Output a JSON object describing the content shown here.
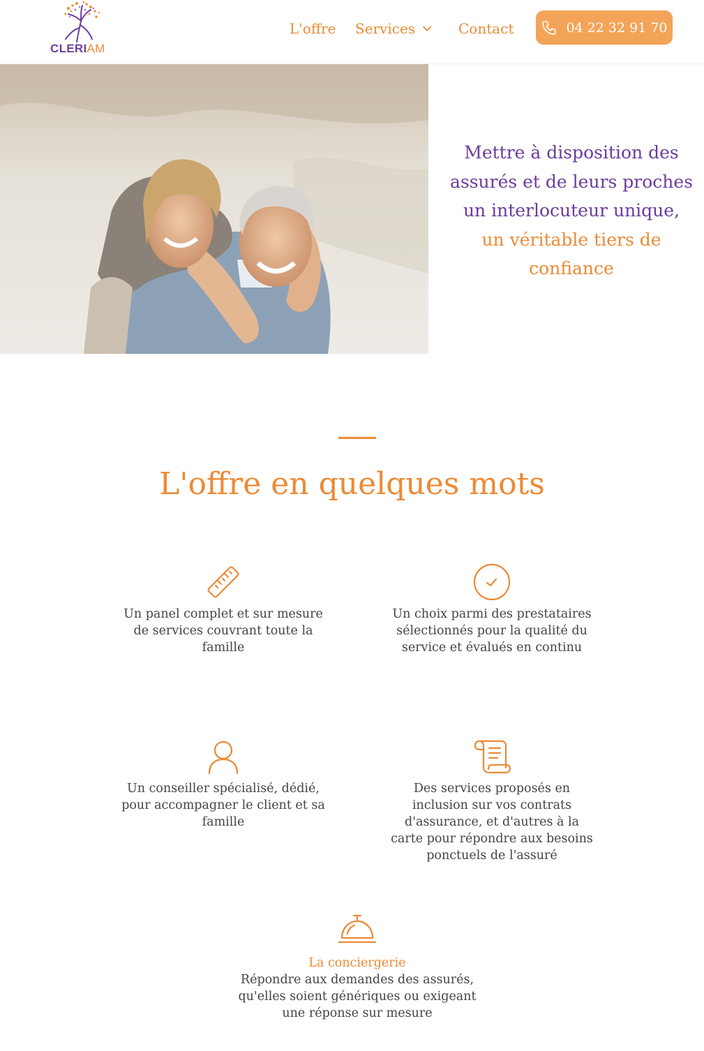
{
  "header": {
    "logo": {
      "part1": "CLERI",
      "part2": "AM"
    },
    "nav": {
      "offre": "L'offre",
      "services": "Services",
      "contact": "Contact"
    },
    "phone": "04 22 32 91 70"
  },
  "hero": {
    "line_purple": "Mettre à disposition des assurés et de leurs proches un interlocuteur unique,",
    "line_orange": "un véritable tiers de confiance"
  },
  "offer": {
    "title": "L'offre en quelques mots",
    "features": [
      {
        "icon": "ruler-icon",
        "text": "Un panel complet et sur mesure de services couvrant toute la famille"
      },
      {
        "icon": "check-circle-icon",
        "text": "Un choix parmi des prestataires sélectionnés pour la qualité du service et évalués en continu"
      },
      {
        "icon": "user-icon",
        "text": "Un conseiller spécialisé, dédié, pour accompagner le client et sa famille"
      },
      {
        "icon": "scroll-icon",
        "text": "Des services proposés en inclusion sur vos contrats d'assurance, et d'autres à la carte pour répondre aux besoins ponctuels de l'assuré"
      }
    ],
    "concierge": {
      "icon": "service-bell-icon",
      "title": "La conciergerie",
      "text": "Répondre aux demandes des assurés, qu'elles soient génériques ou exigeant une réponse sur mesure"
    }
  },
  "colors": {
    "accent": "#ec8a36",
    "brand_purple": "#6b3c9b",
    "button": "#f3a458"
  }
}
